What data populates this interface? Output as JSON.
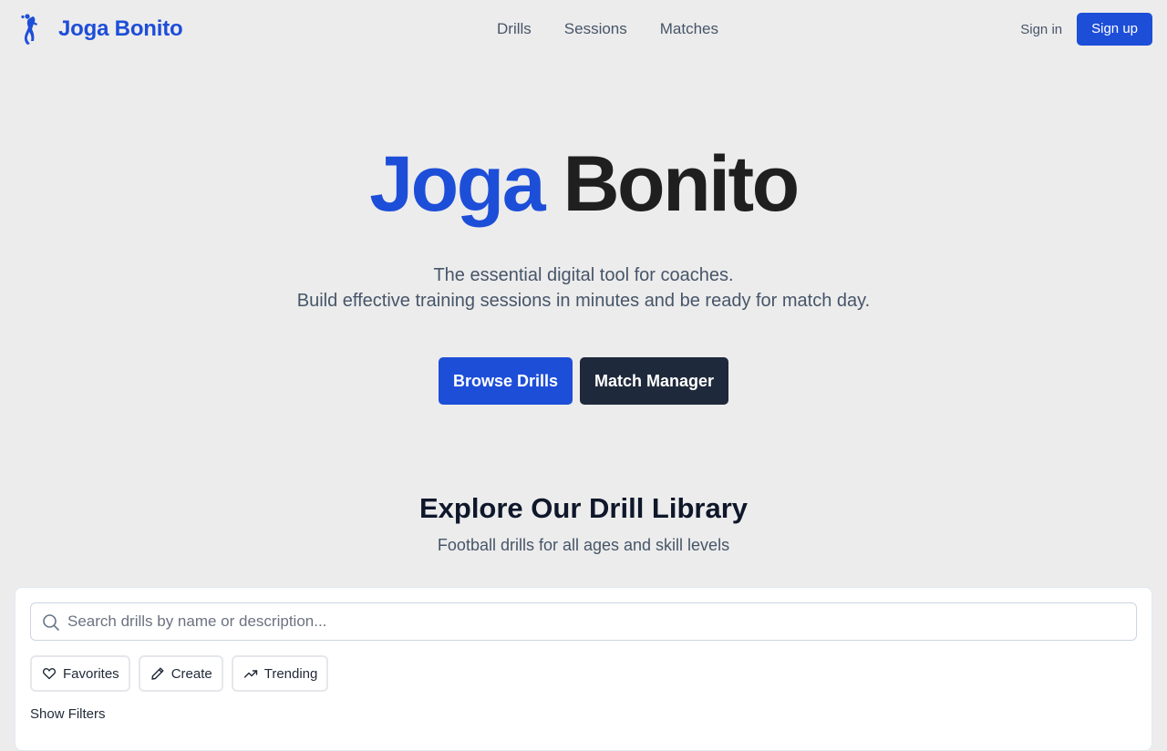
{
  "header": {
    "brand_name": "Joga Bonito",
    "brand_icon": "footballer-kick-icon",
    "nav": [
      {
        "label": "Drills"
      },
      {
        "label": "Sessions"
      },
      {
        "label": "Matches"
      }
    ],
    "sign_in_label": "Sign in",
    "sign_up_label": "Sign up"
  },
  "hero": {
    "title_part1": "Joga",
    "title_part2": "Bonito",
    "subtitle_line1": "The essential digital tool for coaches.",
    "subtitle_line2": "Build effective training sessions in minutes and be ready for match day.",
    "primary_cta": "Browse Drills",
    "secondary_cta": "Match Manager"
  },
  "library": {
    "title": "Explore Our Drill Library",
    "subtitle": "Football drills for all ages and skill levels",
    "search_placeholder": "Search drills by name or description...",
    "search_value": "",
    "chips": [
      {
        "label": "Favorites",
        "icon": "heart-icon"
      },
      {
        "label": "Create",
        "icon": "pencil-icon"
      },
      {
        "label": "Trending",
        "icon": "trending-up-icon"
      }
    ],
    "show_filters_label": "Show Filters"
  },
  "colors": {
    "brand_blue": "#1d4ed8",
    "dark_button": "#1e293b",
    "page_background": "#ececec"
  }
}
